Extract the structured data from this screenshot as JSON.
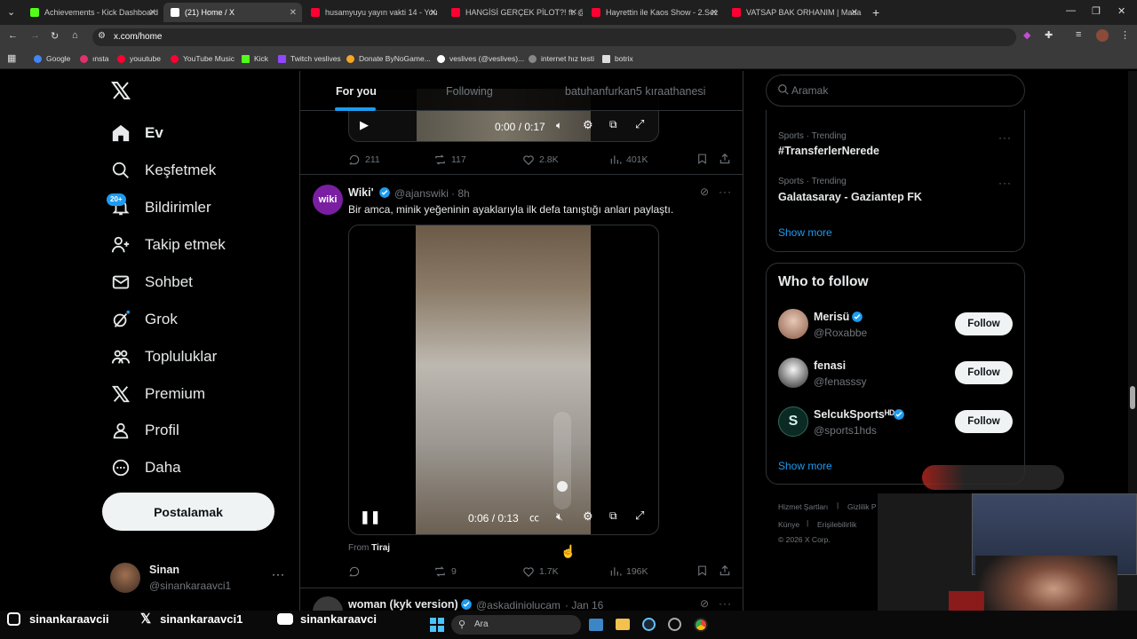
{
  "browser": {
    "tabs": [
      {
        "title": "Achievements - Kick Dashboard",
        "color": "#53fc18"
      },
      {
        "title": "(21) Home / X",
        "color": "#ffffff",
        "active": true
      },
      {
        "title": "husamyuyu yayın vakti 14 - You",
        "color": "#ff0033"
      },
      {
        "title": "HANGİSİ GERÇEK PİLOT?! ft. @",
        "color": "#ff0033"
      },
      {
        "title": "Hayrettin ile Kaos Show - 2.Sez",
        "color": "#ff0033"
      },
      {
        "title": "VATSAP BAK ORHANIM | Mada",
        "color": "#ff0033"
      }
    ],
    "url": "x.com/home",
    "bookmarks": [
      {
        "label": "Google",
        "color": "#4285f4"
      },
      {
        "label": "ınsta",
        "color": "#e1306c"
      },
      {
        "label": "youutube",
        "color": "#ff0033"
      },
      {
        "label": "YouTube Music",
        "color": "#ff0033"
      },
      {
        "label": "Kick",
        "color": "#53fc18"
      },
      {
        "label": "Twitch veslives",
        "color": "#9146ff"
      },
      {
        "label": "Donate ByNoGame...",
        "color": "#f5a623"
      },
      {
        "label": "veslives (@veslives)...",
        "color": "#ffffff"
      },
      {
        "label": "internet hız testi",
        "color": "#888888"
      },
      {
        "label": "botrix",
        "color": "#dddddd"
      }
    ]
  },
  "sidebar": {
    "items": [
      {
        "label": "Ev",
        "icon": "home-icon"
      },
      {
        "label": "Keşfetmek",
        "icon": "search-icon"
      },
      {
        "label": "Bildirimler",
        "icon": "bell-icon",
        "badge": "20+"
      },
      {
        "label": "Takip etmek",
        "icon": "add-person-icon"
      },
      {
        "label": "Sohbet",
        "icon": "mail-icon"
      },
      {
        "label": "Grok",
        "icon": "grok-icon"
      },
      {
        "label": "Topluluklar",
        "icon": "people-icon"
      },
      {
        "label": "Premium",
        "icon": "x-logo-icon"
      },
      {
        "label": "Profil",
        "icon": "person-icon"
      },
      {
        "label": "Daha",
        "icon": "more-circle-icon"
      }
    ],
    "post_label": "Postalamak",
    "account": {
      "name": "Sinan",
      "handle": "@sinankaraavci1"
    }
  },
  "feed": {
    "tabs": [
      "For you",
      "Following",
      "batuhanfurkan5 kıraathanesi"
    ],
    "prev_post": {
      "video_time": "0:00 / 0:17",
      "replies": "211",
      "reposts": "117",
      "likes": "2.8K",
      "views": "401K"
    },
    "post": {
      "avatar_text": "wiki",
      "name": "Wiki'",
      "handle": "@ajanswiki",
      "time": "· 8h",
      "text": "Bir amca, minik yeğeninin ayaklarıyla ilk defa tanıştığı anları paylaştı.",
      "video_time": "0:06 / 0:13",
      "from_label": "From",
      "from_source": "Tiraj",
      "replies": "",
      "reposts": "9",
      "likes": "1.7K",
      "views": "196K"
    },
    "next_post": {
      "name": "woman (kyk version)",
      "handle": "@askadiniolucam",
      "time": "· Jan 16"
    }
  },
  "right": {
    "search_placeholder": "Aramak",
    "trends": [
      {
        "meta": "Sports · Trending",
        "name": "#TransferlerNerede"
      },
      {
        "meta": "Sports · Trending",
        "name": "Galatasaray - Gaziantep FK"
      }
    ],
    "show_more": "Show more",
    "who_to_follow": "Who to follow",
    "follow_label": "Follow",
    "suggestions": [
      {
        "name": "Merisü",
        "handle": "@Roxabbe",
        "verified": true
      },
      {
        "name": "fenasi",
        "handle": "@fenasssy",
        "verified": false
      },
      {
        "name": "SelcukSportsᴴᴰ",
        "handle": "@sports1hds",
        "verified": true
      }
    ],
    "footer": [
      "Hizmet Şartları",
      "Gizlilik P",
      "Künye",
      "Erişilebilirlik",
      "© 2026 X Corp."
    ]
  },
  "overlay": {
    "socials": [
      {
        "label": "sinankaraavcii",
        "icon": "instagram-icon"
      },
      {
        "label": "sinankaraavci1",
        "icon": "x-logo-icon"
      },
      {
        "label": "sinankaraavci",
        "icon": "youtube-icon"
      }
    ],
    "taskbar_search": "Ara"
  },
  "colors": {
    "accent": "#1d9bf0",
    "bg": "#000000",
    "border": "#2f3336",
    "muted": "#71767b"
  }
}
